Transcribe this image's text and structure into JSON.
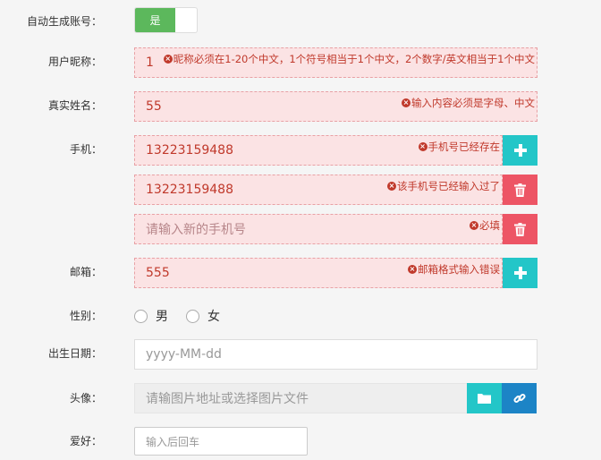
{
  "auto_account": {
    "label": "自动生成账号：",
    "toggle_on": "是"
  },
  "nickname": {
    "label": "用户昵称：",
    "value": "1",
    "error": "昵称必须在1-20个中文，1个符号相当于1个中文，2个数字/英文相当于1个中文"
  },
  "realname": {
    "label": "真实姓名：",
    "value": "55",
    "error": "输入内容必须是字母、中文"
  },
  "phone": {
    "label": "手机：",
    "rows": [
      {
        "value": "13223159488",
        "error": "手机号已经存在"
      },
      {
        "value": "13223159488",
        "error": "该手机号已经输入过了"
      },
      {
        "placeholder": "请输入新的手机号",
        "error": "必填"
      }
    ]
  },
  "email": {
    "label": "邮箱：",
    "value": "555",
    "error": "邮箱格式输入错误"
  },
  "gender": {
    "label": "性别：",
    "options": [
      "男",
      "女"
    ]
  },
  "birthday": {
    "label": "出生日期：",
    "placeholder": "yyyy-MM-dd"
  },
  "avatar": {
    "label": "头像：",
    "placeholder": "请输图片地址或选择图片文件"
  },
  "hobby": {
    "label": "爱好：",
    "placeholder": "输入后回车"
  },
  "icons": {
    "error": "x-circle-icon",
    "add": "plus-icon",
    "delete": "trash-icon",
    "folder": "folder-icon",
    "link": "link-icon"
  }
}
